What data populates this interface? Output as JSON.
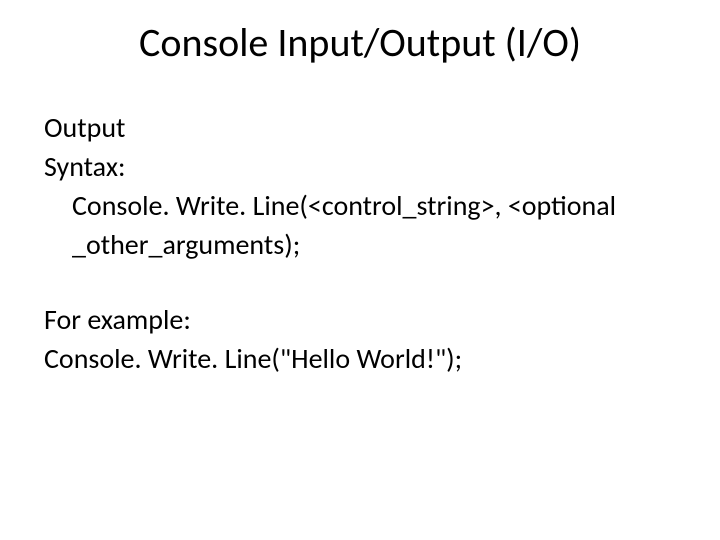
{
  "title": "Console Input/Output (I/O)",
  "lines": {
    "l1": "Output",
    "l2": "Syntax:",
    "l3": "Console. Write. Line(<control_string>, <optional",
    "l4": "_other_arguments);",
    "l5": "For example:",
    "l6": "Console. Write. Line(\"Hello World!\");"
  }
}
